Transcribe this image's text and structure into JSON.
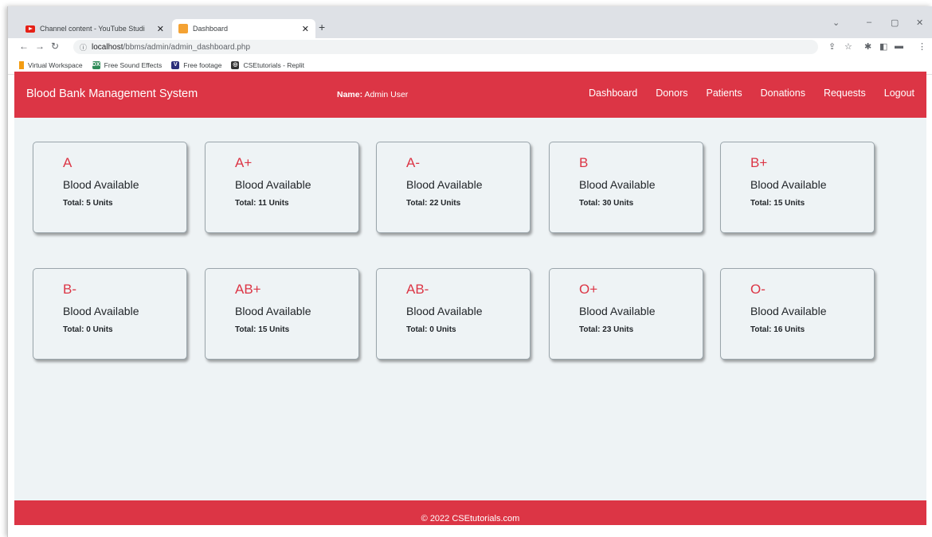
{
  "browser": {
    "tabs": [
      {
        "title": "Channel content - YouTube Studi",
        "favicon": "youtube-icon"
      },
      {
        "title": "Dashboard",
        "favicon": "dashboard-favicon"
      }
    ],
    "url_host": "localhost",
    "url_path": "/bbms/admin/admin_dashboard.php",
    "bookmarks": [
      {
        "label": "Virtual Workspace",
        "icon": "virtual-workspace-icon"
      },
      {
        "label": "Free Sound Effects",
        "icon": "sound-effects-icon",
        "icon_text": "DX"
      },
      {
        "label": "Free footage",
        "icon": "footage-icon",
        "icon_text": "V"
      },
      {
        "label": "CSEtutorials - Replit",
        "icon": "replit-icon",
        "icon_text": "◎"
      }
    ]
  },
  "navbar": {
    "brand": "Blood Bank Management System",
    "user_label": "Name:",
    "user_name": "Admin User",
    "links": [
      "Dashboard",
      "Donors",
      "Patients",
      "Donations",
      "Requests",
      "Logout"
    ]
  },
  "cards": [
    {
      "group": "A",
      "title": "Blood Available",
      "total": "Total: 5 Units"
    },
    {
      "group": "A+",
      "title": "Blood Available",
      "total": "Total: 11 Units"
    },
    {
      "group": "A-",
      "title": "Blood Available",
      "total": "Total: 22 Units"
    },
    {
      "group": "B",
      "title": "Blood Available",
      "total": "Total: 30 Units"
    },
    {
      "group": "B+",
      "title": "Blood Available",
      "total": "Total: 15 Units"
    },
    {
      "group": "B-",
      "title": "Blood Available",
      "total": "Total: 0 Units"
    },
    {
      "group": "AB+",
      "title": "Blood Available",
      "total": "Total: 15 Units"
    },
    {
      "group": "AB-",
      "title": "Blood Available",
      "total": "Total: 0 Units"
    },
    {
      "group": "O+",
      "title": "Blood Available",
      "total": "Total: 23 Units"
    },
    {
      "group": "O-",
      "title": "Blood Available",
      "total": "Total: 16 Units"
    }
  ],
  "footer": {
    "text": "© 2022 CSEtutorials.com"
  },
  "colors": {
    "primary": "#dc3545",
    "background": "#eef3f5"
  }
}
